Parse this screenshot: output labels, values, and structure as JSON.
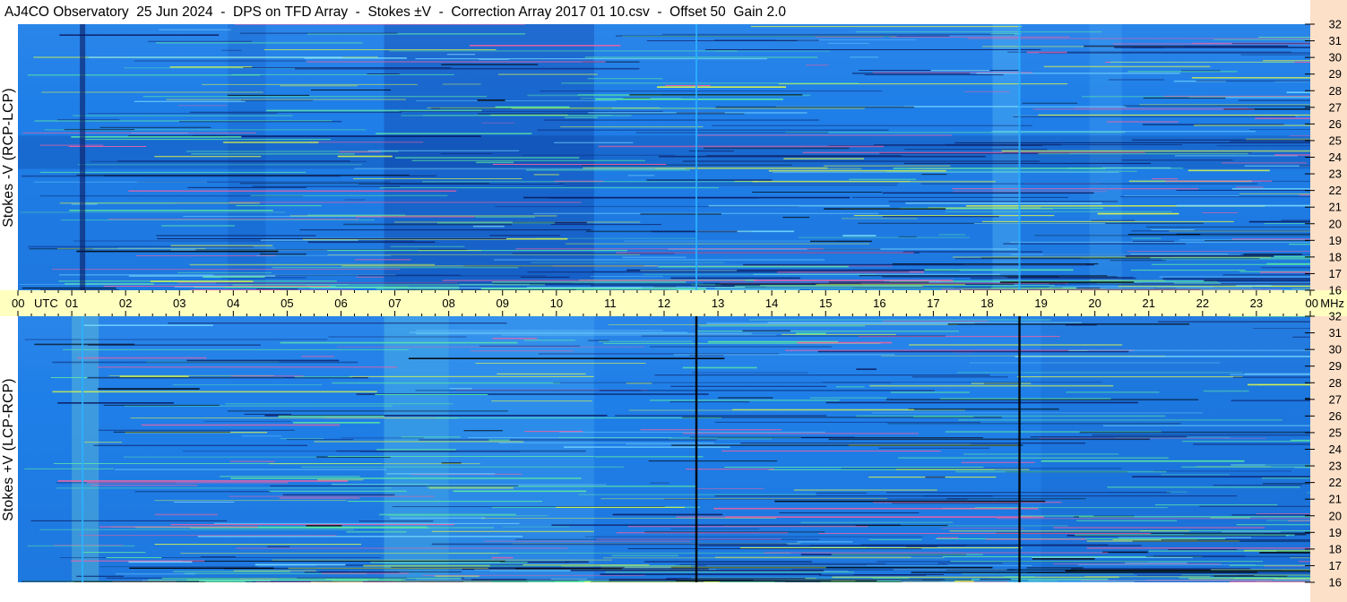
{
  "title": "AJ4CO Observatory  25 Jun 2024  -  DPS on TFD Array  -  Stokes ±V  -  Correction Array 2017 01 10.csv  -  Offset 50  Gain 2.0",
  "colors": {
    "background_blue": "#1f7fe8",
    "time_axis_bg": "#ffffc0",
    "freq_axis_bg": "#fde0c8",
    "line_cyan": "#2ab0ff",
    "line_black": "#000000",
    "line_yellow": "#e8ff40",
    "line_green": "#60f0a0",
    "line_dark": "#0a1a60"
  },
  "chart_data": [
    {
      "type": "heatmap",
      "title": "",
      "ylabel": "Stokes -V (RCP-LCP)",
      "xlabel": "UTC",
      "x_ticks": [
        "00",
        "01",
        "02",
        "03",
        "04",
        "05",
        "06",
        "07",
        "08",
        "09",
        "10",
        "11",
        "12",
        "13",
        "14",
        "15",
        "16",
        "17",
        "18",
        "19",
        "20",
        "21",
        "22",
        "23",
        "00"
      ],
      "y_unit": "MHz",
      "y_ticks": [
        "16",
        "17",
        "18",
        "19",
        "20",
        "21",
        "22",
        "23",
        "24",
        "25",
        "26",
        "27",
        "28",
        "29",
        "30",
        "31",
        "32"
      ],
      "ylim": [
        16,
        32
      ],
      "xlim_hours": [
        0,
        24
      ],
      "vertical_features": [
        {
          "hour": 1.2,
          "kind": "dark"
        },
        {
          "hour": 12.6,
          "kind": "cyan"
        },
        {
          "hour": 18.6,
          "kind": "cyan"
        }
      ]
    },
    {
      "type": "heatmap",
      "title": "",
      "ylabel": "Stokes +V (LCP-RCP)",
      "xlabel": "UTC",
      "x_ticks": [
        "00",
        "01",
        "02",
        "03",
        "04",
        "05",
        "06",
        "07",
        "08",
        "09",
        "10",
        "11",
        "12",
        "13",
        "14",
        "15",
        "16",
        "17",
        "18",
        "19",
        "20",
        "21",
        "22",
        "23",
        "00"
      ],
      "y_unit": "MHz",
      "y_ticks": [
        "16",
        "17",
        "18",
        "19",
        "20",
        "21",
        "22",
        "23",
        "24",
        "25",
        "26",
        "27",
        "28",
        "29",
        "30",
        "31",
        "32"
      ],
      "ylim": [
        16,
        32
      ],
      "xlim_hours": [
        0,
        24
      ],
      "vertical_features": [
        {
          "hour": 1.2,
          "kind": "cyan"
        },
        {
          "hour": 12.6,
          "kind": "black"
        },
        {
          "hour": 18.6,
          "kind": "black"
        }
      ]
    }
  ]
}
